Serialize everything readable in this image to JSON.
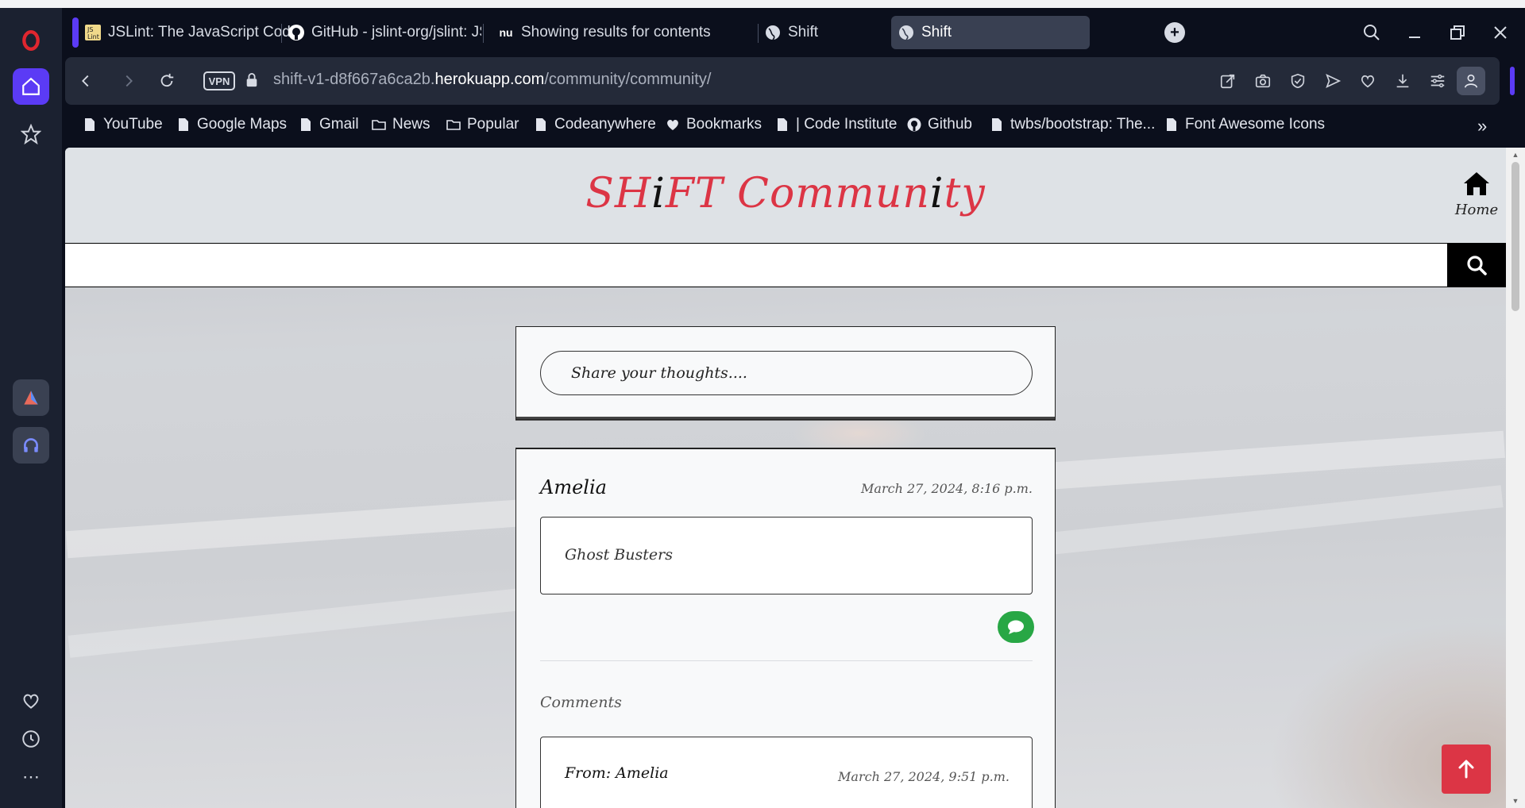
{
  "browser": {
    "tabs": [
      {
        "label": "JSLint: The JavaScript Code Quality and Coverage Tool",
        "icon": "jslint-icon"
      },
      {
        "label": "GitHub - jslint-org/jslint: JSLint",
        "icon": "github-icon"
      },
      {
        "label": "Showing results for contents",
        "icon": "nu-icon"
      },
      {
        "label": "Shift",
        "icon": "globe-icon"
      },
      {
        "label": "Shift",
        "icon": "globe-icon",
        "active": true
      }
    ],
    "address": {
      "vpn_label": "VPN",
      "url_prefix": "shift-v1-d8f667a6ca2b.",
      "url_host": "herokuapp.com",
      "url_path": "/community/community/"
    },
    "bookmarks": [
      {
        "label": "YouTube",
        "icon": "page-icon"
      },
      {
        "label": "Google Maps",
        "icon": "page-icon"
      },
      {
        "label": "Gmail",
        "icon": "page-icon"
      },
      {
        "label": "News",
        "icon": "folder-icon"
      },
      {
        "label": "Popular",
        "icon": "folder-icon"
      },
      {
        "label": "Codeanywhere",
        "icon": "page-icon"
      },
      {
        "label": "Bookmarks",
        "icon": "heart-icon"
      },
      {
        "label": "| Code Institute",
        "icon": "page-icon"
      },
      {
        "label": "Github",
        "icon": "github-icon"
      },
      {
        "label": "twbs/bootstrap: The...",
        "icon": "page-icon"
      },
      {
        "label": "Font Awesome Icons",
        "icon": "page-icon"
      }
    ],
    "bookmarks_more": "»"
  },
  "site": {
    "title_parts": [
      "SH",
      "i",
      "FT Commun",
      "i",
      "ty"
    ],
    "home_label": "Home",
    "search_placeholder": "",
    "compose_placeholder": "Share your thoughts....",
    "post": {
      "author": "Amelia",
      "date": "March 27, 2024, 8:16 p.m.",
      "text": "Ghost Busters"
    },
    "comments_heading": "Comments",
    "comment": {
      "from": "From: Amelia",
      "date": "March 27, 2024, 9:51 p.m."
    }
  },
  "colors": {
    "brand_red": "#dc3545",
    "comment_green": "#28a745",
    "opera_accent": "#5b3bf5"
  }
}
